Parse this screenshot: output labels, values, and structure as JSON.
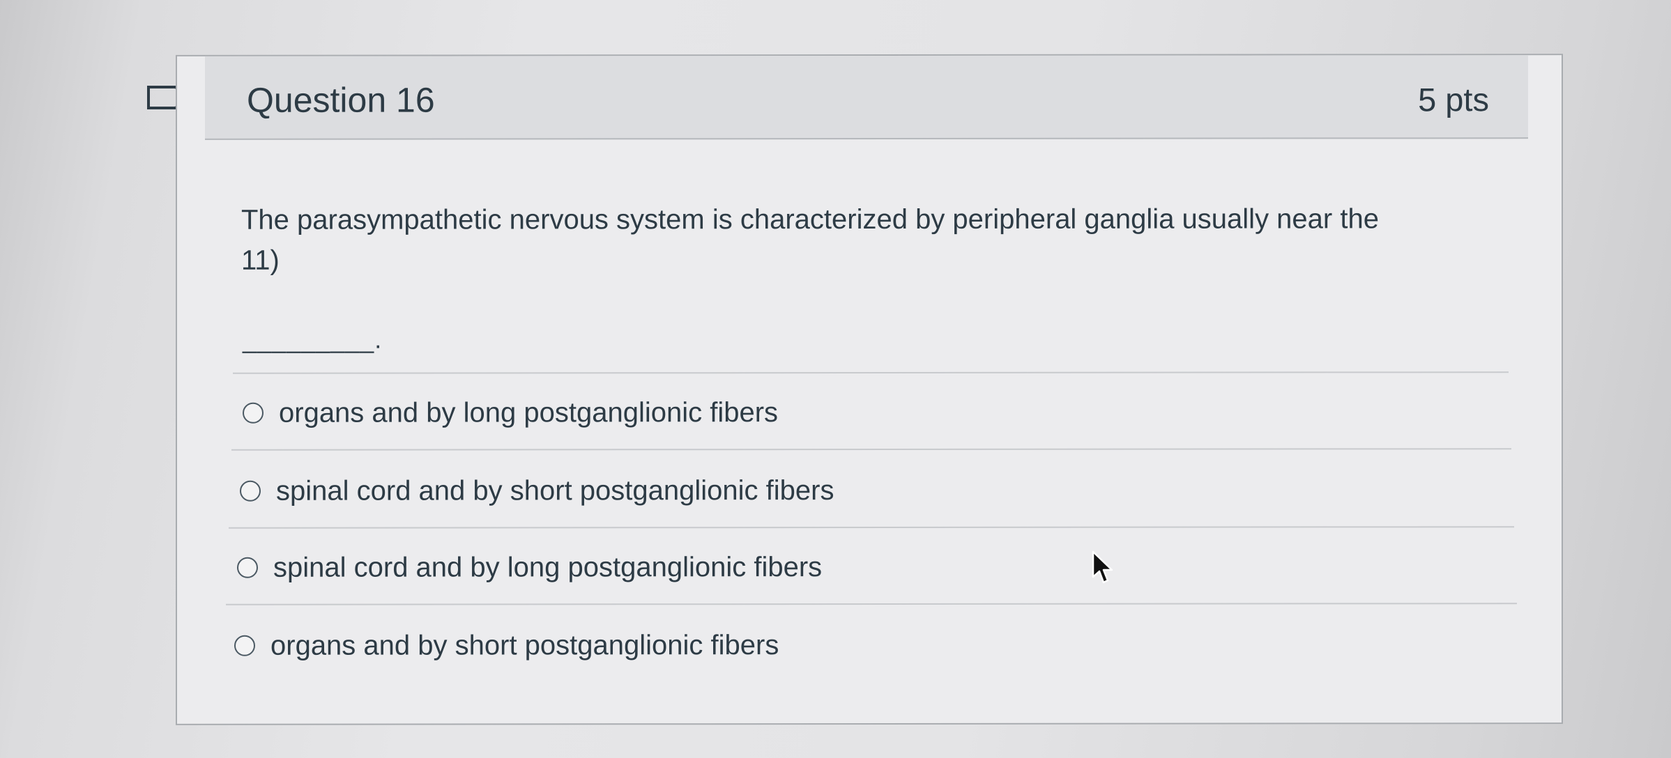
{
  "question": {
    "title": "Question 16",
    "points": "5 pts",
    "text": "The parasympathetic nervous system is characterized by peripheral ganglia usually near the\n11)",
    "blank": "_________."
  },
  "answers": [
    {
      "label": "organs and by long postganglionic fibers",
      "selected": false
    },
    {
      "label": "spinal cord and by short postganglionic fibers",
      "selected": false
    },
    {
      "label": "spinal cord and by long postganglionic fibers",
      "selected": false
    },
    {
      "label": "organs and by short postganglionic fibers",
      "selected": false
    }
  ],
  "icons": {
    "flag": "flag-bookmark-icon",
    "cursor": "mouse-pointer-icon"
  },
  "colors": {
    "text": "#2d3b45",
    "header_bg": "#dcdde0",
    "border": "#a9acb0"
  }
}
